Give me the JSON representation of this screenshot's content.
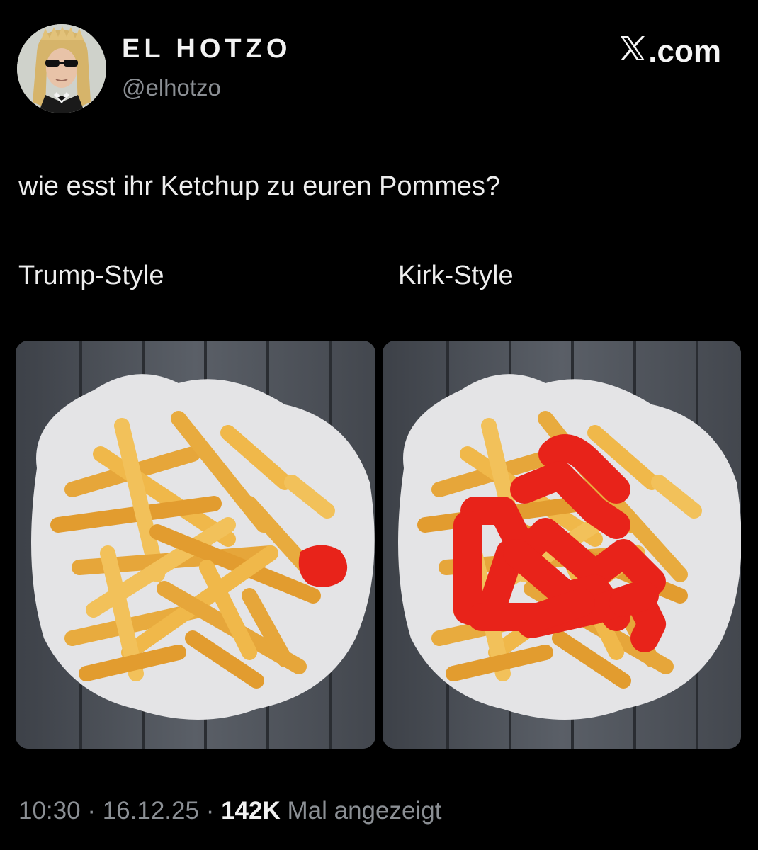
{
  "author": {
    "display_name": "EL HOTZO",
    "handle": "@elhotzo"
  },
  "brand": {
    "label": ".com",
    "icon": "x-logo-icon"
  },
  "post": {
    "text": "wie esst ihr Ketchup zu euren Pommes?",
    "images": [
      {
        "label": "Trump-Style",
        "description_icon": "fries-with-small-ketchup-dot"
      },
      {
        "label": "Kirk-Style",
        "description_icon": "fries-with-ketchup-scribble"
      }
    ]
  },
  "meta": {
    "time": "10:30",
    "separator": "·",
    "date": "16.12.25",
    "views_count": "142K",
    "views_label": "Mal angezeigt"
  },
  "colors": {
    "background": "#000000",
    "primary_text": "#e7e9ea",
    "secondary_text": "#8b8f94",
    "ketchup": "#e8231a"
  }
}
